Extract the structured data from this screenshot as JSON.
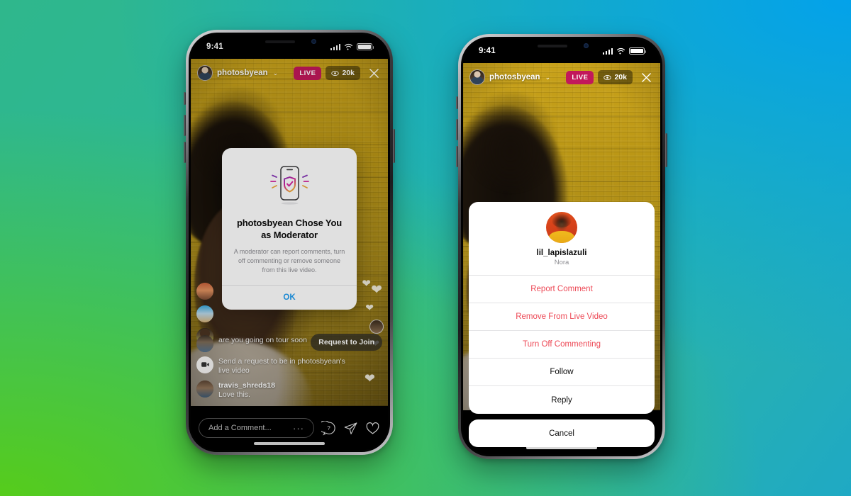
{
  "background": {
    "gradient_top_left": "#2fb78c",
    "gradient_top_right": "#03a2ea",
    "gradient_bottom_left": "#56cc1b",
    "gradient_bottom_right": "#2ab4a8"
  },
  "status_bar": {
    "time": "9:41"
  },
  "live": {
    "username": "photosbyean",
    "chevron": "⌄",
    "live_label": "LIVE",
    "viewer_count": "20k",
    "live_badge_color": "#c2185b",
    "close_label": "×"
  },
  "left_phone": {
    "comments": [
      {
        "name": "",
        "text": "are you going on tour soon"
      },
      {
        "name": "",
        "text": "Send a request to be in photosbyean's live video",
        "is_request": true
      },
      {
        "name": "travis_shreds18",
        "text": "Love this."
      }
    ],
    "request_to_join_label": "Request to Join",
    "composer": {
      "placeholder": "Add a Comment...",
      "more_dots": "···"
    },
    "bottom_icons": [
      "question-circle-icon",
      "paper-plane-icon",
      "heart-icon"
    ],
    "modal": {
      "illustration": "phone-shield-check-icon",
      "title": "photosbyean Chose You as Moderator",
      "description": "A moderator can report comments, turn off commenting or remove someone from this live video.",
      "ok_label": "OK",
      "ok_color": "#1e9bf0"
    }
  },
  "right_phone": {
    "action_sheet": {
      "avatar": "user-avatar",
      "username": "lil_lapislazuli",
      "display_name": "Nora",
      "items": [
        {
          "label": "Report Comment",
          "style": "danger"
        },
        {
          "label": "Remove From Live Video",
          "style": "danger"
        },
        {
          "label": "Turn Off Commenting",
          "style": "danger"
        },
        {
          "label": "Follow",
          "style": "plain"
        },
        {
          "label": "Reply",
          "style": "plain"
        }
      ],
      "cancel_label": "Cancel",
      "danger_color": "#ed4956"
    }
  }
}
